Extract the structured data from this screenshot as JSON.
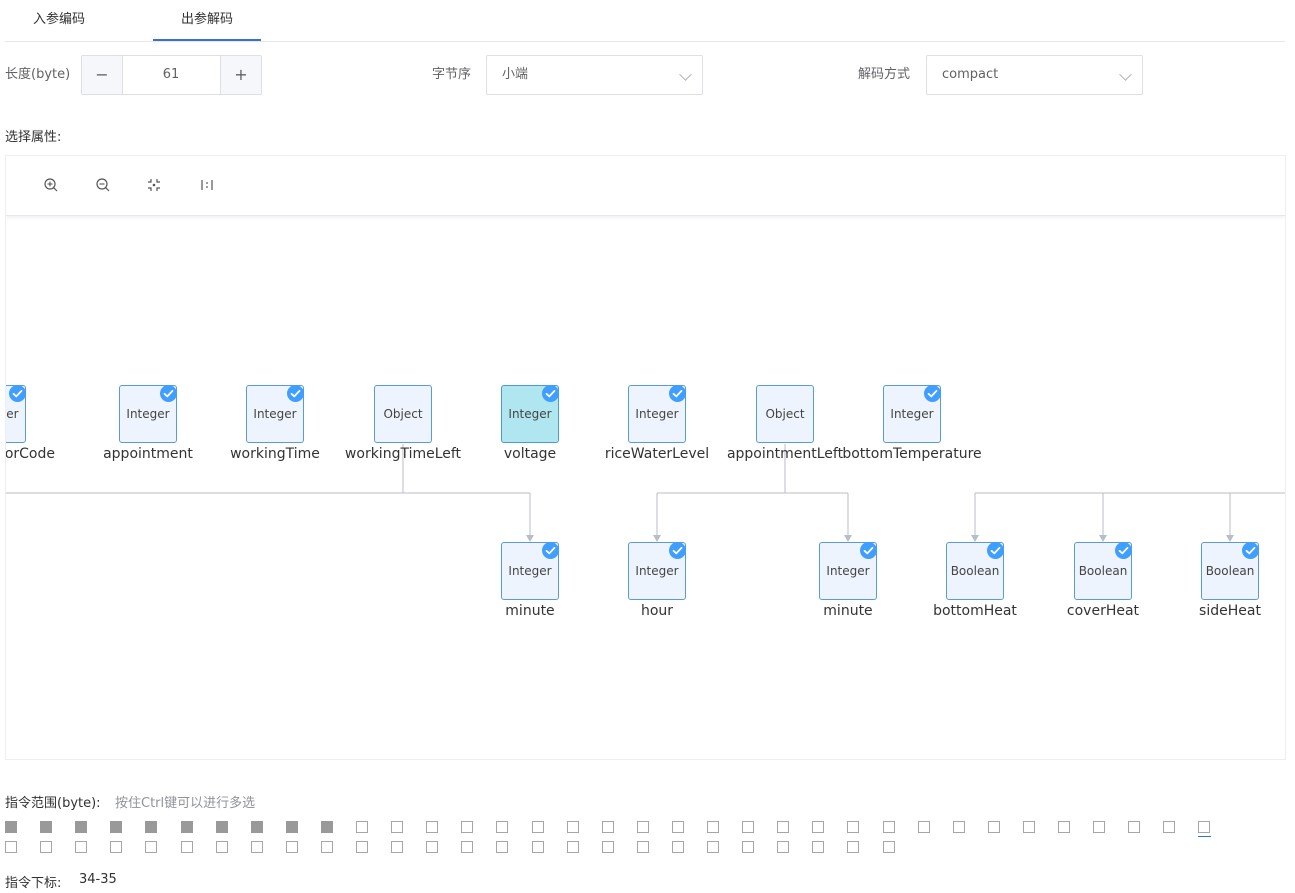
{
  "tabs": [
    {
      "label": "入参编码"
    },
    {
      "label": "出参解码"
    }
  ],
  "form": {
    "length_label": "长度(byte)",
    "length_value": "61",
    "minus_glyph": "−",
    "plus_glyph": "+",
    "byte_order_label": "字节序",
    "byte_order_value": "小端",
    "decode_label": "解码方式",
    "decode_value": "compact"
  },
  "select_attr_label": "选择属性:",
  "toolbar": {
    "icons": [
      "zoom-in-icon",
      "zoom-out-icon",
      "fit-view-icon",
      "actual-size-icon"
    ]
  },
  "graph": {
    "top_nodes": [
      {
        "type": "Integer",
        "name": "orCode",
        "checked": true,
        "selected": false
      },
      {
        "type": "Integer",
        "name": "appointment",
        "checked": true,
        "selected": false
      },
      {
        "type": "Integer",
        "name": "workingTime",
        "checked": true,
        "selected": false
      },
      {
        "type": "Object",
        "name": "workingTimeLeft",
        "checked": false,
        "selected": false
      },
      {
        "type": "Integer",
        "name": "voltage",
        "checked": true,
        "selected": true
      },
      {
        "type": "Integer",
        "name": "riceWaterLevel",
        "checked": true,
        "selected": false
      },
      {
        "type": "Object",
        "name": "appointmentLeft",
        "checked": false,
        "selected": false
      },
      {
        "type": "Integer",
        "name": "bottomTemperature",
        "checked": true,
        "selected": false
      }
    ],
    "child_nodes": [
      {
        "type": "Integer",
        "name": "minute",
        "checked": true
      },
      {
        "type": "Integer",
        "name": "hour",
        "checked": true
      },
      {
        "type": "Integer",
        "name": "minute",
        "checked": true
      },
      {
        "type": "Boolean",
        "name": "bottomHeat",
        "checked": true
      },
      {
        "type": "Boolean",
        "name": "coverHeat",
        "checked": true
      },
      {
        "type": "Boolean",
        "name": "sideHeat",
        "checked": true
      }
    ]
  },
  "range": {
    "label": "指令范围(byte):",
    "hint": "按住Ctrl键可以进行多选",
    "total": 61,
    "filled_count": 10,
    "underlined": [
      34,
      35
    ]
  },
  "index": {
    "label": "指令下标:",
    "value": "34-35"
  },
  "colors": {
    "accent": "#409eff",
    "node_border": "#5b9bd5",
    "node_fill": "#eef4fd",
    "node_selected_fill": "#b0e6f0",
    "edge": "#b8bec8",
    "filled_square": "#999999"
  }
}
